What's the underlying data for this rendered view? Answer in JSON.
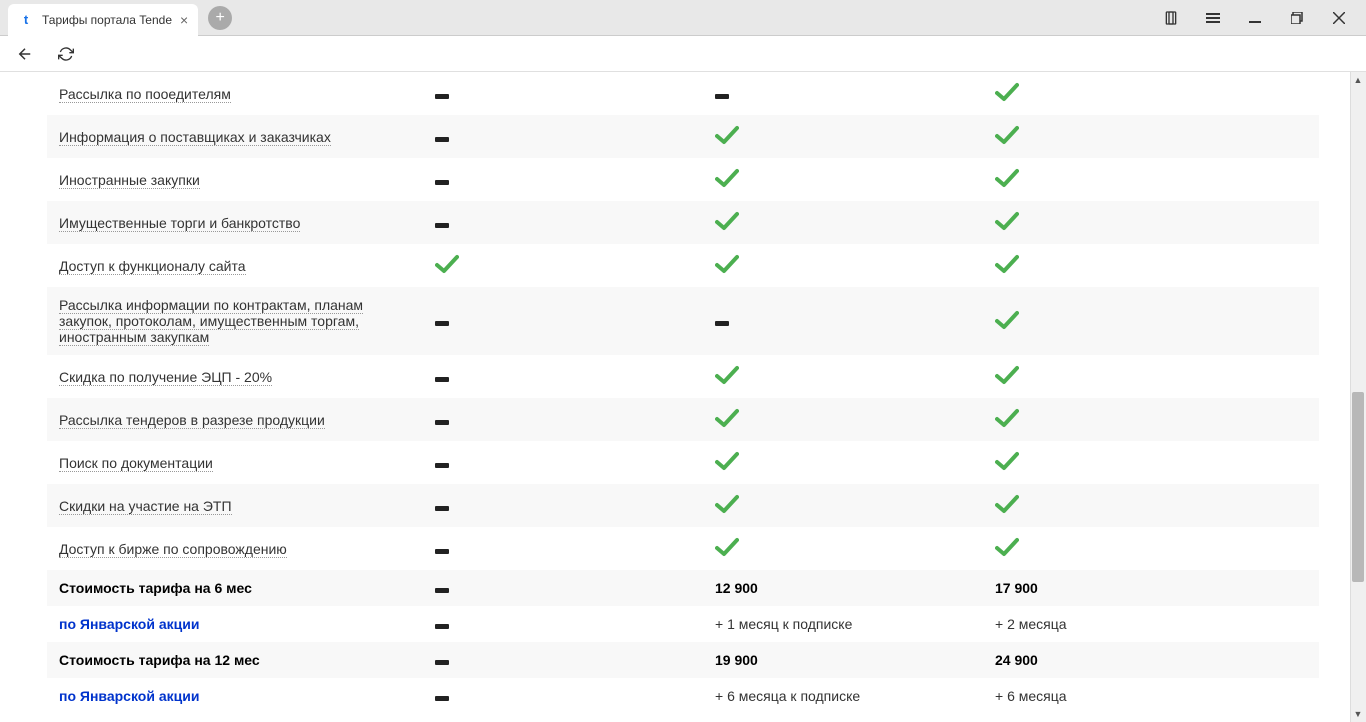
{
  "browser": {
    "tab_title": "Тарифы портала Tende",
    "favicon_letter": "t"
  },
  "features": [
    {
      "label": "Рассылка по пооедителям",
      "dotted": true,
      "plans": [
        "dash",
        "dash",
        "check"
      ]
    },
    {
      "label": "Информация о поставщиках и заказчиках",
      "dotted": true,
      "plans": [
        "dash",
        "check",
        "check"
      ]
    },
    {
      "label": "Иностранные закупки",
      "dotted": true,
      "plans": [
        "dash",
        "check",
        "check"
      ]
    },
    {
      "label": "Имущественные торги и банкротство",
      "dotted": true,
      "plans": [
        "dash",
        "check",
        "check"
      ]
    },
    {
      "label": "Доступ к функционалу сайта",
      "dotted": true,
      "plans": [
        "check",
        "check",
        "check"
      ]
    },
    {
      "label": "Рассылка информации по контрактам, планам закупок, протоколам, имущественным торгам, иностранным закупкам",
      "dotted": true,
      "plans": [
        "dash",
        "dash",
        "check"
      ]
    },
    {
      "label": "Скидка по получение ЭЦП - 20%",
      "dotted": true,
      "plans": [
        "dash",
        "check",
        "check"
      ]
    },
    {
      "label": "Рассылка тендеров в разрезе продукции",
      "dotted": true,
      "plans": [
        "dash",
        "check",
        "check"
      ]
    },
    {
      "label": "Поиск по документации",
      "dotted": true,
      "plans": [
        "dash",
        "check",
        "check"
      ]
    },
    {
      "label": "Скидки на участие на ЭТП",
      "dotted": true,
      "plans": [
        "dash",
        "check",
        "check"
      ]
    },
    {
      "label": "Доступ к бирже по сопровождению",
      "dotted": true,
      "plans": [
        "dash",
        "check",
        "check"
      ]
    }
  ],
  "pricing": [
    {
      "label": "Стоимость тарифа на 6 мес",
      "style": "price",
      "plans": [
        "dash",
        "12 900",
        "17 900"
      ]
    },
    {
      "label": "по Январской акции",
      "style": "promo",
      "plans": [
        "dash",
        "+ 1 месяц к подписке",
        "+ 2 месяца"
      ]
    },
    {
      "label": "Стоимость тарифа на 12 мес",
      "style": "price",
      "plans": [
        "dash",
        "19 900",
        "24 900"
      ]
    },
    {
      "label": "по Январской акции",
      "style": "promo",
      "plans": [
        "dash",
        "+ 6 месяца к подписке",
        "+ 6 месяца"
      ]
    }
  ]
}
